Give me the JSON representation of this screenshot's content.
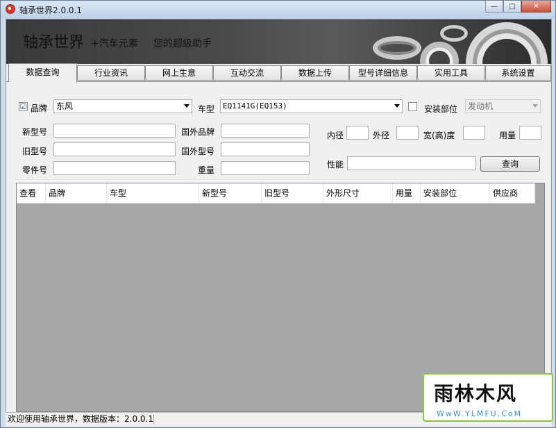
{
  "window": {
    "title": "轴承世界2.0.0.1",
    "controls": {
      "minimize": "—",
      "maximize": "□",
      "close": "✕"
    }
  },
  "banner": {
    "title": "轴承世界",
    "subtitle": "+汽车元素",
    "slogan": "您的超级助手"
  },
  "tabs": [
    {
      "label": "数据查询",
      "active": true
    },
    {
      "label": "行业资讯"
    },
    {
      "label": "网上生意"
    },
    {
      "label": "互动交流"
    },
    {
      "label": "数据上传"
    },
    {
      "label": "型号详细信息"
    },
    {
      "label": "实用工具"
    },
    {
      "label": "系统设置"
    }
  ],
  "search": {
    "brand_checkbox": {
      "label": "品牌",
      "checked": true,
      "mark": "☑"
    },
    "brand_value": "东风",
    "car_model_label": "车型",
    "car_model_value": "EQ1141G(EQ153)",
    "install_checkbox": {
      "label": "安装部位",
      "checked": false
    },
    "install_value": "发动机",
    "new_model_label": "新型号",
    "old_model_label": "旧型号",
    "part_no_label": "零件号",
    "foreign_brand_label": "国外品牌",
    "foreign_model_label": "国外型号",
    "weight_label": "重量",
    "inner_diameter_label": "内径",
    "outer_diameter_label": "外径",
    "width_label": "宽(高)度",
    "usage_label": "用量",
    "performance_label": "性能",
    "query_button": "查询"
  },
  "results_table": {
    "columns": [
      "查看",
      "品牌",
      "车型",
      "新型号",
      "旧型号",
      "外形尺寸",
      "用量",
      "安装部位",
      "供应商"
    ],
    "rows": []
  },
  "statusbar": {
    "text": "欢迎使用轴承世界，数据版本：2.0.0.1"
  },
  "watermark": {
    "logo_text": "雨林木风",
    "url": "WwW.YLMFU.CoM"
  }
}
